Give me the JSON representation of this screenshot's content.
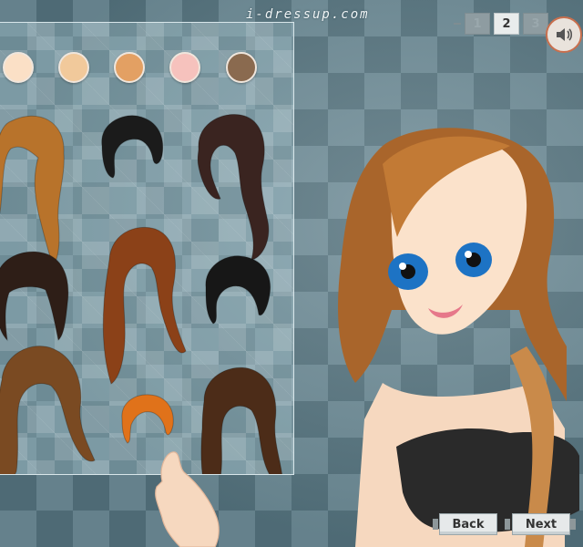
{
  "site": {
    "logo_text": "i-dressup.com"
  },
  "pager": {
    "pages": [
      "1",
      "2",
      "3"
    ],
    "current": "2"
  },
  "sound": {
    "icon": "speaker-icon"
  },
  "skin_tones": [
    "#fbe0c6",
    "#f1c99b",
    "#e3a063",
    "#f6c2bd",
    "#8a6a4f"
  ],
  "hair_options": [
    {
      "name": "long-braid",
      "color": "#b8732b"
    },
    {
      "name": "short-black",
      "color": "#1b1b1b"
    },
    {
      "name": "long-wavy-dark",
      "color": "#3a2420"
    },
    {
      "name": "bob-bangs",
      "color": "#2e1e17"
    },
    {
      "name": "long-auburn",
      "color": "#8b4118"
    },
    {
      "name": "messy-updo-black",
      "color": "#171717"
    },
    {
      "name": "long-layered-brown",
      "color": "#7a4a22"
    },
    {
      "name": "short-orange",
      "color": "#e0721a"
    },
    {
      "name": "long-curly-brown",
      "color": "#4c2c18"
    }
  ],
  "navigation": {
    "back_label": "Back",
    "next_label": "Next"
  }
}
